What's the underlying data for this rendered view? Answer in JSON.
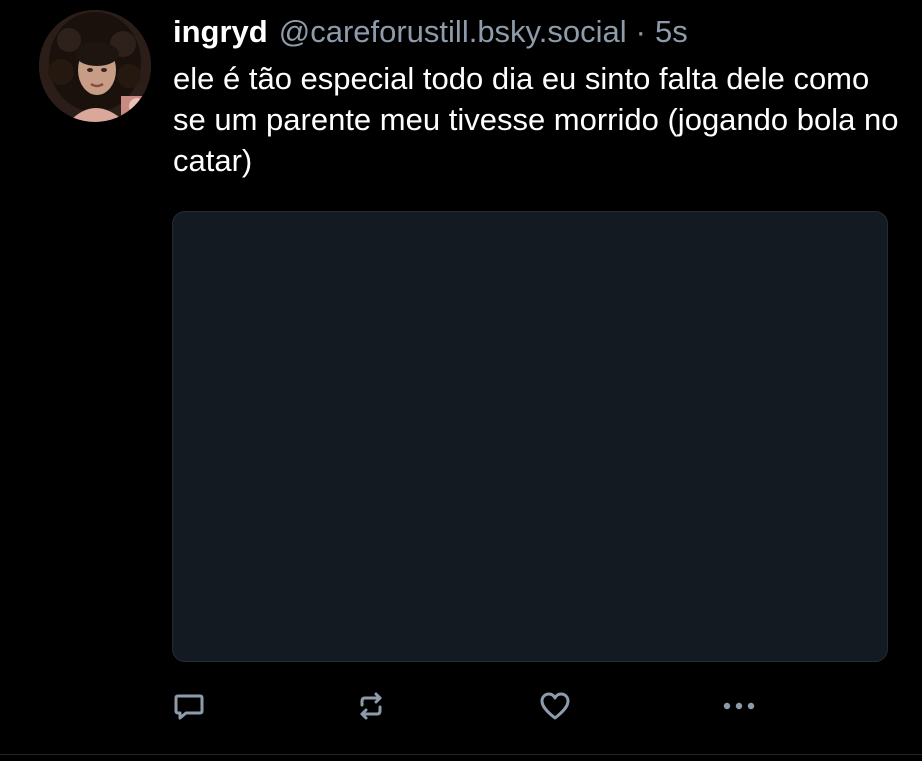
{
  "post": {
    "author_name": "ingryd",
    "author_handle": "@careforustill.bsky.social",
    "separator": "·",
    "timestamp": "5s",
    "text": "ele é tão especial todo dia eu sinto falta dele como se um parente meu tivesse morrido (jogando bola no catar)",
    "avatar_icon": "user-avatar-photo"
  },
  "actions": {
    "reply_icon": "comment-icon",
    "repost_icon": "repost-icon",
    "like_icon": "heart-icon",
    "more_icon": "more-options-icon"
  },
  "colors": {
    "background": "#000000",
    "text": "#ffffff",
    "secondary_text": "#8e9bab",
    "media_background": "#141a21",
    "icon": "#8e9bab"
  }
}
